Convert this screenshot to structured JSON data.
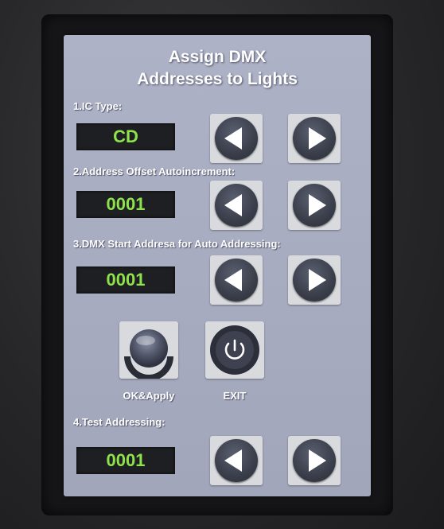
{
  "title_line1": "Assign DMX",
  "title_line2": "Addresses to Lights",
  "sections": [
    {
      "label": "1.IC Type:",
      "value": "CD"
    },
    {
      "label": "2.Address Offset Autoincrement:",
      "value": "0001"
    },
    {
      "label": "3.DMX Start Addresa for Auto Addressing:",
      "value": "0001"
    },
    {
      "label": "4.Test Addressing:",
      "value": "0001"
    }
  ],
  "buttons": {
    "ok_label": "OK&Apply",
    "exit_label": "EXIT"
  },
  "colors": {
    "screen_bg": "#aeb2c6",
    "value_text": "#8ee34a",
    "value_bg": "#1e1f22"
  },
  "icons": [
    "left-arrow-icon",
    "right-arrow-icon",
    "ok-apply-icon",
    "power-icon"
  ]
}
